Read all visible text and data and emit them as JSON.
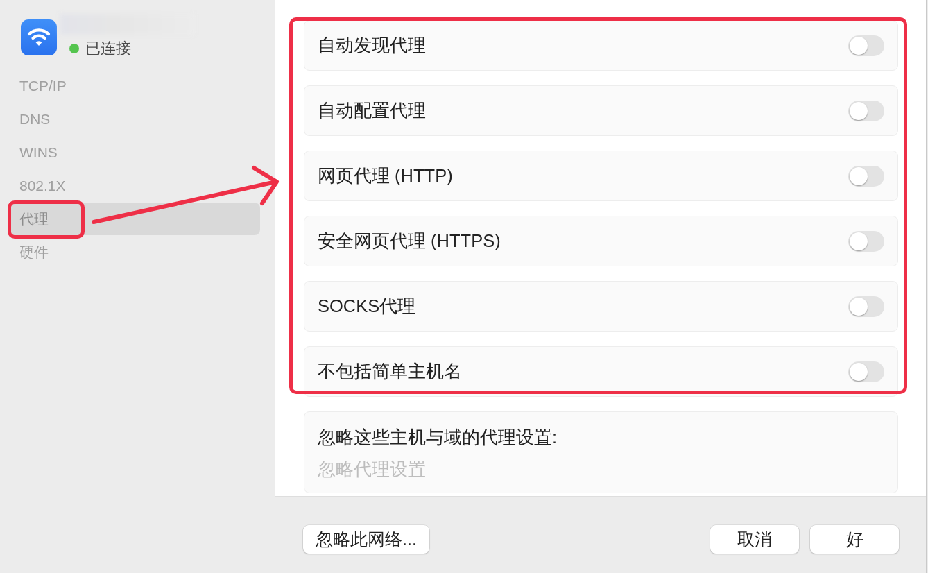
{
  "sidebar": {
    "network": {
      "status": "已连接",
      "connected": true
    },
    "items": [
      {
        "label": "TCP/IP",
        "selected": false
      },
      {
        "label": "DNS",
        "selected": false
      },
      {
        "label": "WINS",
        "selected": false
      },
      {
        "label": "802.1X",
        "selected": false
      },
      {
        "label": "代理",
        "selected": true
      },
      {
        "label": "硬件",
        "selected": false
      }
    ]
  },
  "proxy_settings": [
    {
      "label": "自动发现代理",
      "on": false
    },
    {
      "label": "自动配置代理",
      "on": false
    },
    {
      "label": "网页代理 (HTTP)",
      "on": false
    },
    {
      "label": "安全网页代理 (HTTPS)",
      "on": false
    },
    {
      "label": "SOCKS代理",
      "on": false
    },
    {
      "label": "不包括简单主机名",
      "on": false
    }
  ],
  "bypass": {
    "label": "忽略这些主机与域的代理设置:",
    "placeholder": "忽略代理设置"
  },
  "footer": {
    "left_buttons": [
      "忽略此网络..."
    ],
    "right_buttons": [
      "取消",
      "好"
    ]
  },
  "annotations": [
    {
      "kind": "item-frame"
    },
    {
      "kind": "arrow"
    },
    {
      "kind": "list-frame"
    }
  ]
}
